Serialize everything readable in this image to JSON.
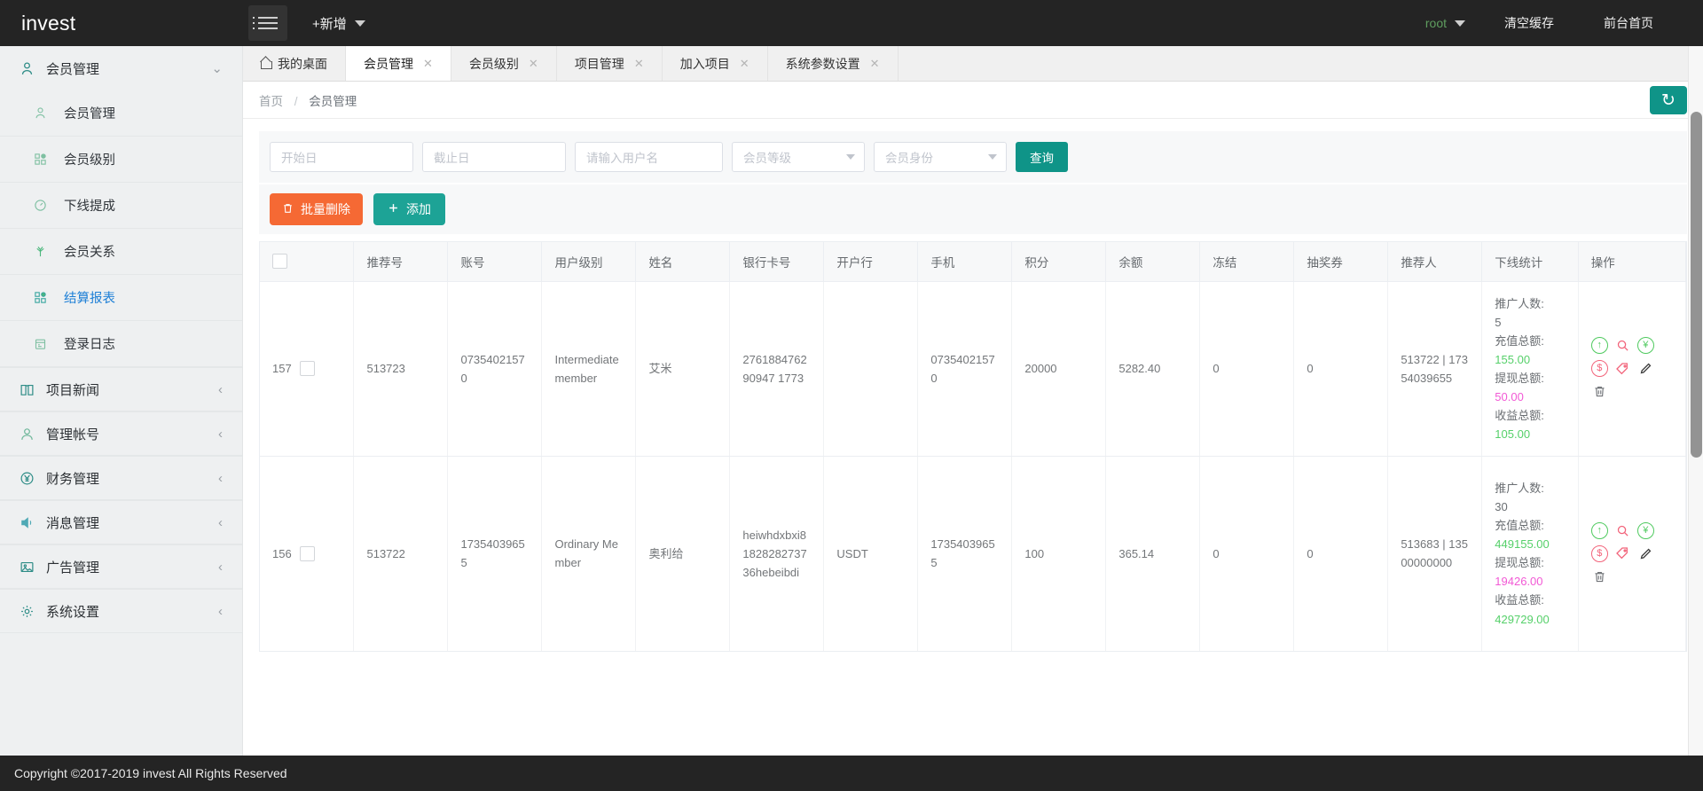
{
  "topbar": {
    "brand": "invest",
    "menu_icon": "hamburger-icon",
    "add_new": "+新增",
    "user": "root",
    "clear_cache": "清空缓存",
    "front_page": "前台首页"
  },
  "sidebar": {
    "groups": [
      {
        "label": "会员管理",
        "icon": "user-icon",
        "expanded": true,
        "chevron": "⌄"
      },
      {
        "label": "项目新闻",
        "icon": "book-icon",
        "expanded": false,
        "chevron": "‹"
      },
      {
        "label": "管理帐号",
        "icon": "account-icon",
        "expanded": false,
        "chevron": "‹"
      },
      {
        "label": "财务管理",
        "icon": "yen-circle-icon",
        "expanded": false,
        "chevron": "‹"
      },
      {
        "label": "消息管理",
        "icon": "speaker-icon",
        "expanded": false,
        "chevron": "‹"
      },
      {
        "label": "广告管理",
        "icon": "image-icon",
        "expanded": false,
        "chevron": "‹"
      },
      {
        "label": "系统设置",
        "icon": "gear-icon",
        "expanded": false,
        "chevron": "‹"
      }
    ],
    "sub_items": [
      {
        "label": "会员管理",
        "icon": "user-icon",
        "active": false
      },
      {
        "label": "会员级别",
        "icon": "grid-icon",
        "active": false
      },
      {
        "label": "下线提成",
        "icon": "gauge-icon",
        "active": false
      },
      {
        "label": "会员关系",
        "icon": "tree-icon",
        "active": false
      },
      {
        "label": "结算报表",
        "icon": "grid-icon",
        "active": true
      },
      {
        "label": "登录日志",
        "icon": "calendar-icon",
        "active": false
      }
    ]
  },
  "tabs": [
    {
      "label": "我的桌面",
      "icon": "home-icon",
      "closable": false,
      "active": false
    },
    {
      "label": "会员管理",
      "closable": true,
      "active": true
    },
    {
      "label": "会员级别",
      "closable": true,
      "active": false
    },
    {
      "label": "项目管理",
      "closable": true,
      "active": false
    },
    {
      "label": "加入项目",
      "closable": true,
      "active": false
    },
    {
      "label": "系统参数设置",
      "closable": true,
      "active": false
    }
  ],
  "breadcrumb": {
    "home": "首页",
    "separator": "/",
    "current": "会员管理"
  },
  "refresh_button": {
    "icon": "refresh-icon",
    "label": "↻"
  },
  "filters": {
    "start_date_placeholder": "开始日",
    "end_date_placeholder": "截止日",
    "username_placeholder": "请输入用户名",
    "level_placeholder": "会员等级",
    "identity_placeholder": "会员身份",
    "query_button": "查询"
  },
  "actions": {
    "batch_delete": "批量删除",
    "batch_delete_icon": "trash-icon",
    "add": "添加",
    "add_icon": "plus-icon"
  },
  "table": {
    "select_all_checkbox": "",
    "headers": [
      "",
      "推荐号",
      "账号",
      "用户级别",
      "姓名",
      "银行卡号",
      "开户行",
      "手机",
      "积分",
      "余额",
      "冻结",
      "抽奖券",
      "推荐人",
      "下线统计",
      "操作"
    ],
    "stat_labels": {
      "promoters": "推广人数:",
      "recharge_total": "充值总额:",
      "withdraw_total": "提现总额:",
      "income_total": "收益总额:"
    },
    "op_icons": [
      "arrow-up-circle-icon",
      "magnifier-icon",
      "yen-circle-icon",
      "dollar-circle-icon",
      "tag-icon",
      "pencil-icon",
      "trash-icon"
    ],
    "rows": [
      {
        "id": "157",
        "referral_no": "513723",
        "account": "07354021570",
        "user_level": "Intermediate member",
        "name": "艾米",
        "bank_card": "276188476290947 1773",
        "bank": "",
        "mobile": "07354021570",
        "points": "20000",
        "balance": "5282.40",
        "frozen": "0",
        "lottery": "0",
        "referrer": "513722 | 17354039655",
        "stats": {
          "promoters": "5",
          "recharge_total": "155.00",
          "withdraw_total": "50.00",
          "income_total": "105.00"
        }
      },
      {
        "id": "156",
        "referral_no": "513722",
        "account": "17354039655",
        "user_level": "Ordinary Member",
        "name": "奥利给",
        "bank_card": "heiwhdxbxi8182828273736hebeibdi",
        "bank": "USDT",
        "mobile": "17354039655",
        "points": "100",
        "balance": "365.14",
        "frozen": "0",
        "lottery": "0",
        "referrer": "513683 | 13500000000",
        "stats": {
          "promoters": "30",
          "recharge_total": "449155.00",
          "withdraw_total": "19426.00",
          "income_total": "429729.00"
        }
      }
    ]
  },
  "footer": {
    "text": "Copyright ©2017-2019 invest All Rights Reserved"
  },
  "colors": {
    "accent_teal": "#0f9488",
    "danger_orange": "#f56934",
    "green_value": "#56d06a",
    "pink_value": "#f259d5",
    "link_blue": "#1d7fd6"
  }
}
